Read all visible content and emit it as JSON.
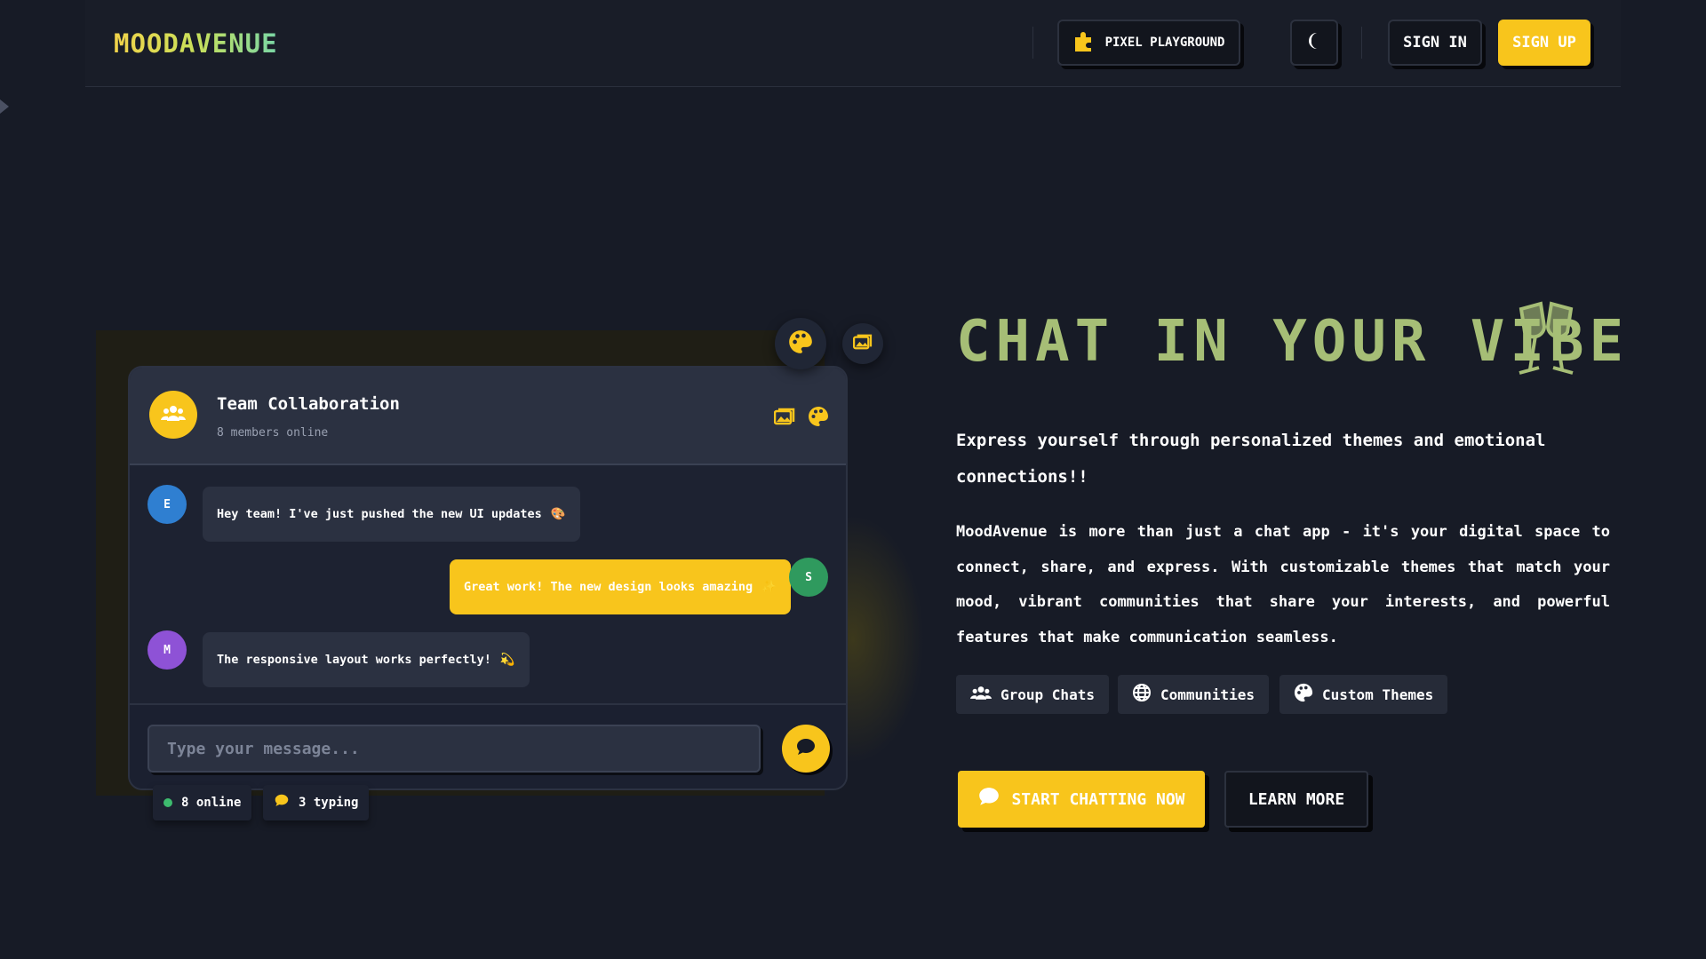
{
  "header": {
    "logo": "MOODAVENUE",
    "pixel_playground_label": "PIXEL PLAYGROUND",
    "sign_in_label": "SIGN IN",
    "sign_up_label": "SIGN UP"
  },
  "chat": {
    "group_name": "Team Collaboration",
    "members_online": "8 members online",
    "messages": [
      {
        "avatar": "E",
        "avatar_color": "#2f7fd1",
        "text": "Hey team! I've just pushed the new UI updates",
        "emoji": "🎨",
        "direction": "incoming"
      },
      {
        "avatar": "S",
        "avatar_color": "#2f9a5e",
        "text": "Great work! The new design looks amazing",
        "emoji": "✨",
        "direction": "outgoing"
      },
      {
        "avatar": "M",
        "avatar_color": "#8e52d6",
        "text": "The responsive layout works perfectly!",
        "emoji": "💫",
        "direction": "incoming"
      }
    ],
    "input_placeholder": "Type your message...",
    "status": {
      "online": "8 online",
      "typing": "3 typing"
    }
  },
  "hero": {
    "title": "CHAT IN YOUR VIBE",
    "lead": "Express yourself through personalized themes and emotional connections!!",
    "body": "MoodAvenue is more than just a chat app - it's your digital space to connect, share, and express. With customizable themes that match your mood, vibrant communities that share your interests, and powerful features that make communication seamless.",
    "features": [
      "Group Chats",
      "Communities",
      "Custom Themes"
    ],
    "cta_primary": "START CHATTING NOW",
    "cta_secondary": "LEARN MORE"
  },
  "colors": {
    "accent": "#f8c51c",
    "background": "#171b26",
    "title": "#a6be76",
    "online_dot": "#3dbb6e"
  },
  "icons": [
    "puzzle-icon",
    "moon-icon",
    "palette-icon",
    "image-icon",
    "users-icon",
    "send-icon",
    "chat-bubble-icon",
    "globe-icon",
    "champagne-glasses-icon"
  ]
}
